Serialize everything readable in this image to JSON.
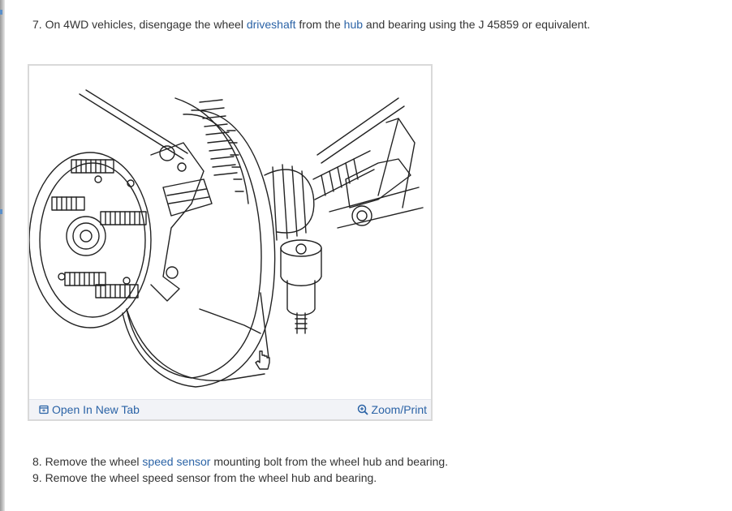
{
  "steps": {
    "step7": {
      "text_1": "7. On 4WD vehicles, disengage the wheel ",
      "link_driveshaft": "driveshaft",
      "text_2": " from the ",
      "link_hub": "hub",
      "text_3": " and bearing using the J 45859 or equivalent."
    },
    "step8": {
      "text_1": "8. Remove the wheel ",
      "link_speed_sensor": "speed sensor",
      "text_2": " mounting bolt from the wheel hub and bearing."
    },
    "step9": {
      "text": "9. Remove the wheel speed sensor from the wheel hub and bearing."
    }
  },
  "figure": {
    "open_new_tab": "Open In New Tab",
    "zoom_print": "Zoom/Print",
    "icons": {
      "open_tab": "open-new-tab-icon",
      "zoom": "zoom-in-icon"
    }
  },
  "colors": {
    "link": "#2b63a6",
    "text": "#333333",
    "bar_bg": "#f2f3f7",
    "frame": "#d9d9d9"
  }
}
